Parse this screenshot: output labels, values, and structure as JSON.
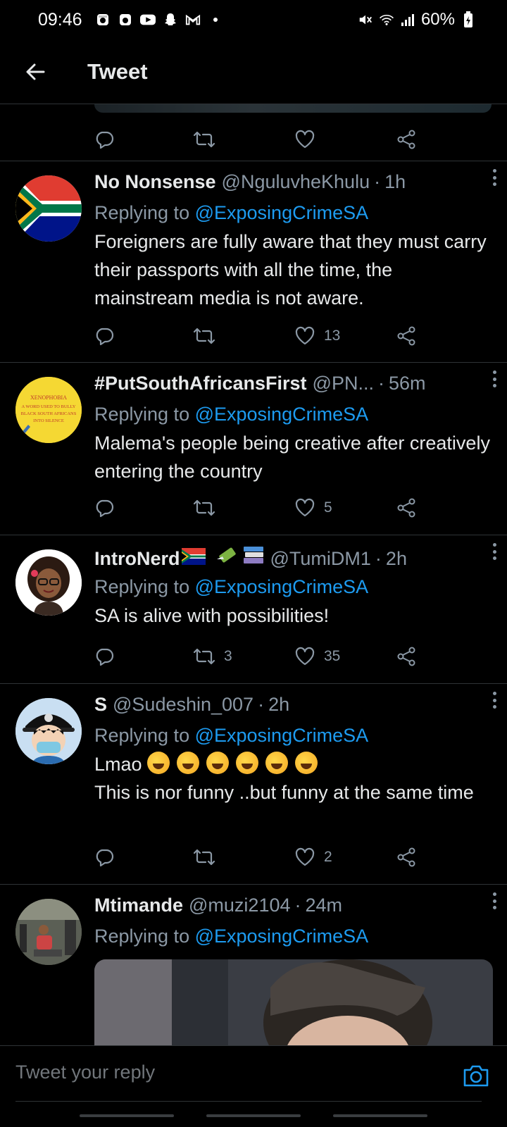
{
  "status_bar": {
    "time": "09:46",
    "battery": "60%",
    "icons": [
      "instagram-icon",
      "instagram-icon",
      "youtube-icon",
      "snapchat-icon",
      "gmail-icon",
      "notification-dot-icon",
      "mute-icon",
      "wifi-icon",
      "signal-icon",
      "battery-icon"
    ]
  },
  "header": {
    "title": "Tweet"
  },
  "top_actions": {
    "reply": "",
    "retweet": "",
    "like": "",
    "share": ""
  },
  "tweets": [
    {
      "name": "No Nonsense",
      "handle": "@NguluvheKhulu",
      "time": "1h",
      "replying_prefix": "Replying to",
      "replying_to": "@ExposingCrimeSA",
      "text": "Foreigners are fully aware that they must carry their passports with all the time, the mainstream media is not aware.",
      "retweets": "",
      "likes": "13"
    },
    {
      "name": "#PutSouthAfricansFirst",
      "handle": "@PN...",
      "time": "56m",
      "replying_prefix": "Replying to",
      "replying_to": "@ExposingCrimeSA",
      "text": "Malema's people being creative after creatively entering the country",
      "retweets": "",
      "likes": "5",
      "avatar_text": "XENOPHOBIA A WORD USED TO BULLY BLACK SOUTH AFRICANS INTO SILENCE"
    },
    {
      "name": "IntroNerd",
      "handle": "@TumiDM1",
      "time": "2h",
      "replying_prefix": "Replying to",
      "replying_to": "@ExposingCrimeSA",
      "text": "SA is alive with possibilities!",
      "retweets": "3",
      "likes": "35"
    },
    {
      "name": "S",
      "handle": "@Sudeshin_007",
      "time": "2h",
      "replying_prefix": "Replying to",
      "replying_to": "@ExposingCrimeSA",
      "text_line1": "Lmao",
      "text": "This is nor funny ..but funny at the same time",
      "retweets": "",
      "likes": "2"
    },
    {
      "name": "Mtimande",
      "handle": "@muzi2104",
      "time": "24m",
      "replying_prefix": "Replying to",
      "replying_to": "@ExposingCrimeSA"
    }
  ],
  "reply_bar": {
    "placeholder": "Tweet your reply"
  },
  "colors": {
    "accent": "#1d9bf0",
    "muted": "#8b98a5",
    "background": "#000000"
  }
}
